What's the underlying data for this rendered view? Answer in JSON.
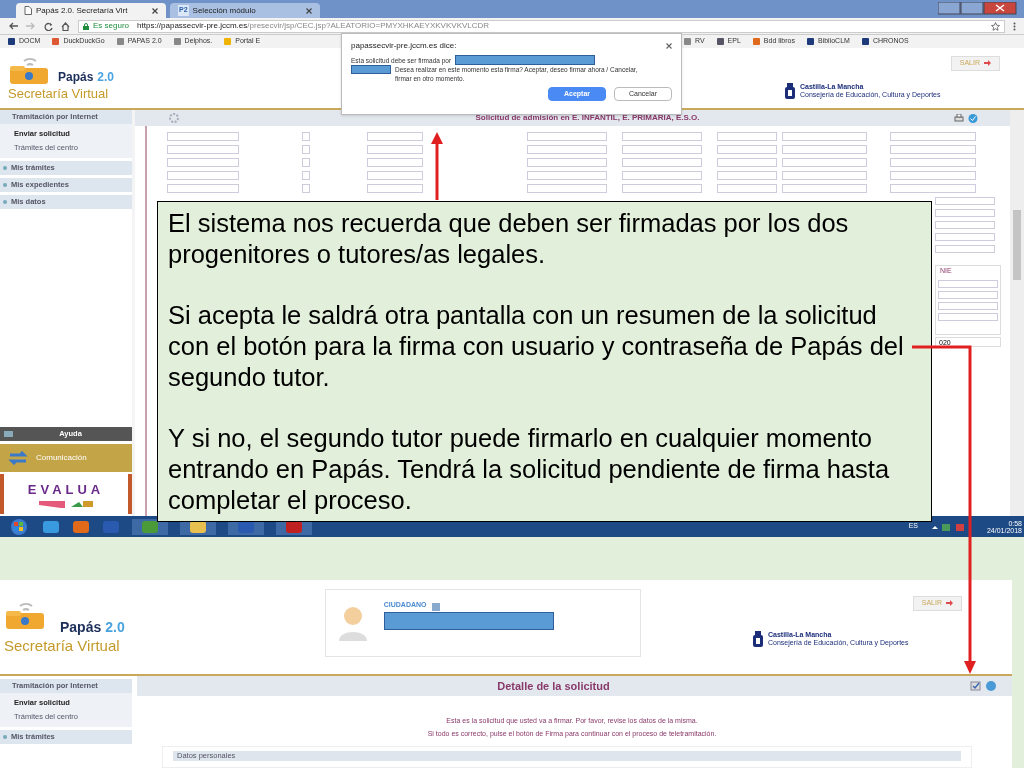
{
  "browser": {
    "tabs": [
      {
        "label": "Papás 2.0. Secretaría Virt",
        "selected": true
      },
      {
        "label": "Selección módulo",
        "selected": false,
        "badge": "P2"
      }
    ],
    "secure_label": "Es seguro",
    "url_host": "https://papassecvir-pre.jccm.es",
    "url_path": "/presecvir/jsp/CEC.jsp?ALEATORIO=PMYXHKAEYXKVKVKVLCDR",
    "bookmarks_left": [
      "DOCM",
      "DuckDuckGo",
      "PAPAS 2.0",
      "Delphos.",
      "Portal E"
    ],
    "bookmarks_right": [
      "RV",
      "EPL",
      "Bdd libros",
      "BiblioCLM",
      "CHRONOS"
    ]
  },
  "dialog": {
    "origin": "papassecvir-pre.jccm.es dice:",
    "message_start": "Esta solicitud debe ser firmada por",
    "message_end": "Desea realizar en este momento esta firma? Aceptar, deseo firmar ahora / Cancelar, firmar en otro momento.",
    "buttons": [
      {
        "label": "Aceptar",
        "kind": "primary"
      },
      {
        "label": "Cancelar",
        "kind": "secondary"
      }
    ]
  },
  "top_page": {
    "logo": {
      "name": "Papás",
      "version": "2.0",
      "subtitle": "Secretaría Virtual"
    },
    "logout": "SALIR",
    "region": "Castilla-La Mancha",
    "department": "Consejería de Educación, Cultura y Deportes",
    "sidebar": {
      "section": "Tramitación por Internet",
      "items": [
        {
          "label": "Enviar solicitud",
          "selected": true
        },
        {
          "label": "Trámites del centro",
          "selected": false
        }
      ],
      "menus": [
        "Mis trámites",
        "Mis expedientes",
        "Mis datos"
      ],
      "help": "Ayuda",
      "banners": [
        "Comunicación",
        "EVALUA"
      ]
    },
    "title": "Solicitud de admisión en E. INFANTIL, E. PRIMARIA, E.S.O.",
    "fragments": [
      "NIE",
      "020"
    ],
    "form_checks": [
      {
        "checked": false
      },
      {
        "checked": false
      },
      {
        "checked": false
      },
      {
        "checked": false
      },
      {
        "checked": false
      }
    ]
  },
  "taskbar": {
    "language": "ES",
    "time": "0:58",
    "date": "24/01/2018"
  },
  "callout": {
    "paragraphs": [
      "El sistema nos recuerda que deben ser firmadas por los dos progenitores o tutores/as legales.",
      "Si acepta le saldrá otra pantalla con un resumen de la solicitud con el botón para la firma con usuario y contraseña de Papás del segundo tutor.",
      "Y si no, el segundo tutor puede firmarlo en cualquier momento entrando en Papás. Tendrá la solicitud pendiente de firma hasta completar el proceso."
    ]
  },
  "bottom_page": {
    "logo": {
      "name": "Papás",
      "version": "2.0",
      "subtitle": "Secretaría Virtual"
    },
    "user_label": "CIUDADANO",
    "logout": "SALIR",
    "region": "Castilla-La Mancha",
    "department": "Consejería de Educación, Cultura y Deportes",
    "sidebar": {
      "section": "Tramitación por Internet",
      "items": [
        {
          "label": "Enviar solicitud",
          "selected": true
        },
        {
          "label": "Trámites del centro",
          "selected": false
        }
      ],
      "menus": [
        "Mis trámites"
      ]
    },
    "title": "Detalle de la solicitud",
    "notice": [
      "Esta es la solicitud que usted va a firmar. Por favor, revise los datos de la misma.",
      "Si todo es correcto, pulse el botón de Firma para continuar con el proceso de teletramitación."
    ],
    "section": "Datos personales"
  }
}
